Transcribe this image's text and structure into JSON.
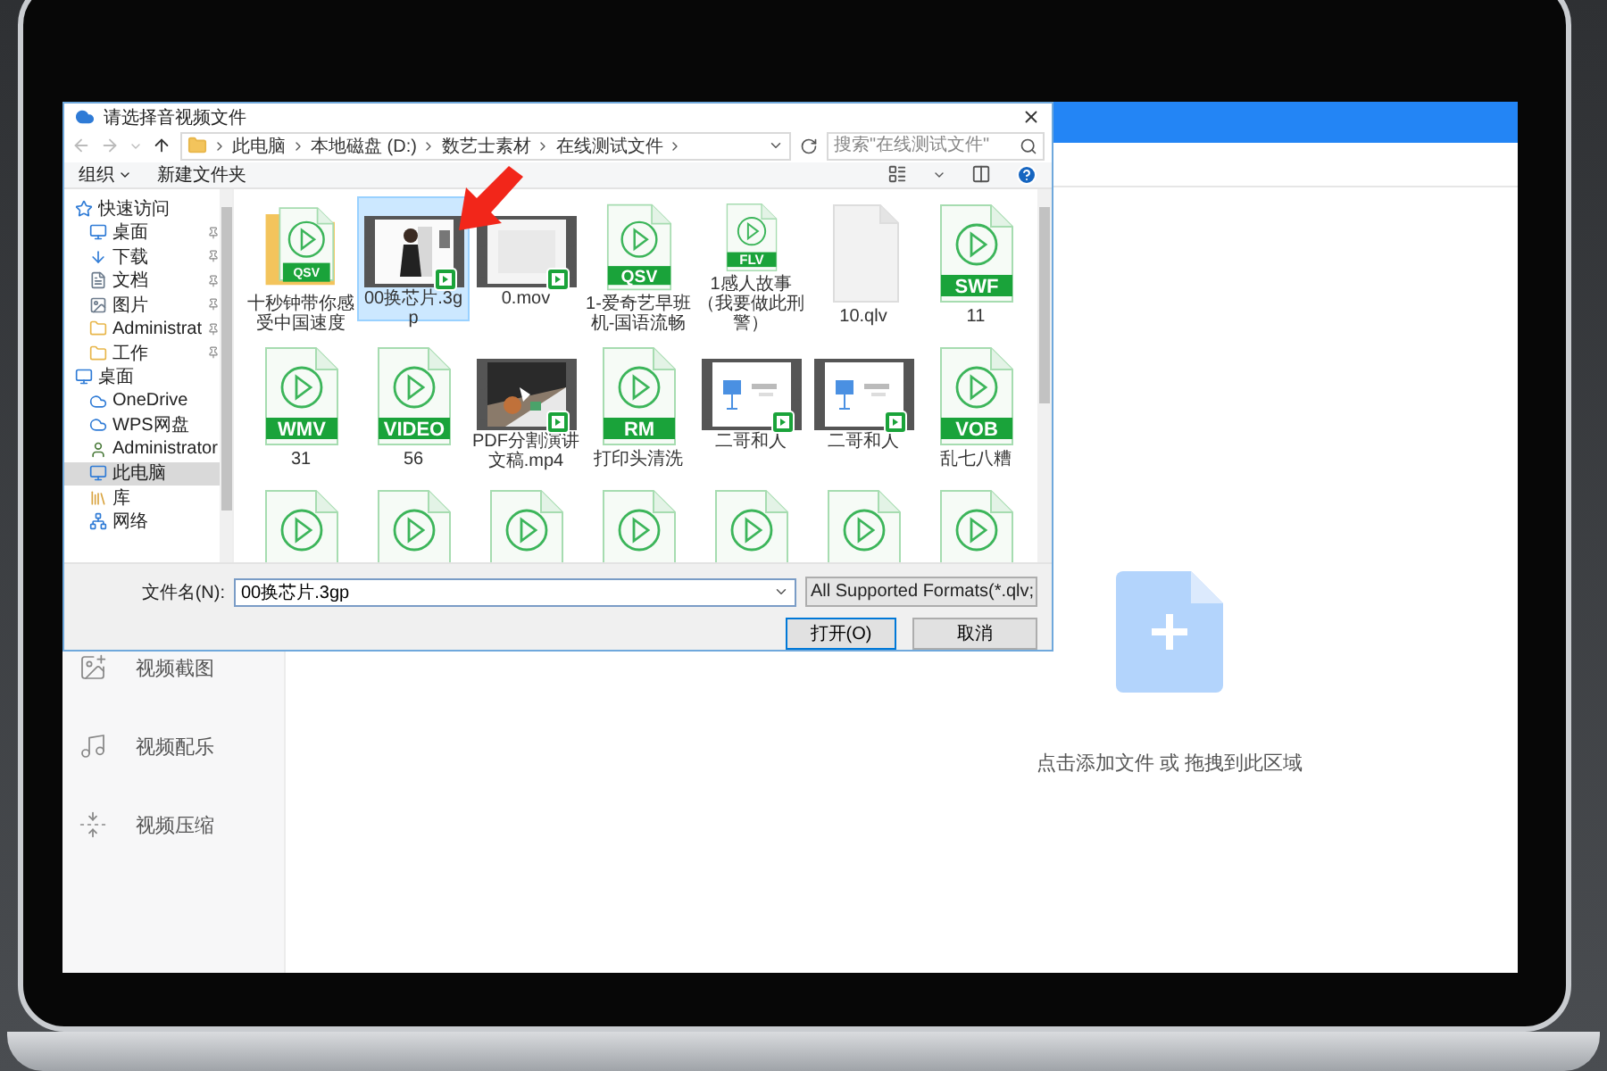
{
  "app": {
    "sidebar": {
      "items": [
        {
          "label": "视频截图",
          "kind": "screenshot"
        },
        {
          "label": "视频配乐",
          "kind": "music"
        },
        {
          "label": "视频压缩",
          "kind": "compress"
        }
      ]
    },
    "drop_zone": {
      "text": "点击添加文件 或 拖拽到此区域"
    }
  },
  "dialog": {
    "title": "请选择音视频文件",
    "path": [
      "此电脑",
      "本地磁盘 (D:)",
      "数艺士素材",
      "在线测试文件"
    ],
    "search": {
      "placeholder": "搜索\"在线测试文件\""
    },
    "toolbar": [
      {
        "label": "组织",
        "dropdown": true
      },
      {
        "label": "新建文件夹",
        "dropdown": false
      }
    ],
    "nav": [
      {
        "label": "快速访问",
        "kind": "star",
        "selected": false,
        "children": [
          {
            "label": "桌面",
            "kind": "desktop",
            "pinned": true,
            "selected": false
          },
          {
            "label": "下载",
            "kind": "download",
            "pinned": true,
            "selected": false
          },
          {
            "label": "文档",
            "kind": "docs",
            "pinned": true,
            "selected": false
          },
          {
            "label": "图片",
            "kind": "pictures",
            "pinned": true,
            "selected": false
          },
          {
            "label": "Administrat",
            "kind": "folder",
            "pinned": true,
            "selected": false
          },
          {
            "label": "工作",
            "kind": "folder",
            "pinned": true,
            "selected": false
          }
        ]
      },
      {
        "label": "桌面",
        "kind": "desktop",
        "selected": false,
        "children": [
          {
            "label": "OneDrive",
            "kind": "cloud",
            "pinned": false,
            "selected": false
          },
          {
            "label": "WPS网盘",
            "kind": "cloud",
            "pinned": false,
            "selected": false
          },
          {
            "label": "Administrator",
            "kind": "user",
            "pinned": false,
            "selected": false
          },
          {
            "label": "此电脑",
            "kind": "computer",
            "pinned": false,
            "selected": true
          },
          {
            "label": "库",
            "kind": "library",
            "pinned": false,
            "selected": false
          },
          {
            "label": "网络",
            "kind": "network",
            "pinned": false,
            "selected": false
          }
        ]
      }
    ],
    "files": [
      {
        "kind": "folder-doc",
        "badge": "QSV",
        "label": "十秒钟带你感受中国速度",
        "selected": false
      },
      {
        "kind": "video",
        "label": "00换芯片.3gp",
        "selected": true
      },
      {
        "kind": "video",
        "label": "0.mov",
        "selected": false
      },
      {
        "kind": "doc",
        "badge": "QSV",
        "label": "1-爱奇艺早班机-国语流畅",
        "selected": false
      },
      {
        "kind": "doc",
        "badge": "FLV",
        "label": "1感人故事（我要做此刑警）",
        "selected": false
      },
      {
        "kind": "blank",
        "label": "10.qlv",
        "selected": false
      },
      {
        "kind": "doc",
        "badge": "SWF",
        "label": "11",
        "selected": false
      },
      {
        "kind": "doc",
        "badge": "WMV",
        "label": "31",
        "selected": false
      },
      {
        "kind": "doc",
        "badge": "VIDEO",
        "label": "56",
        "selected": false
      },
      {
        "kind": "video",
        "label": "PDF分割演讲文稿.mp4",
        "selected": false
      },
      {
        "kind": "doc",
        "badge": "RM",
        "label": "打印头清洗",
        "selected": false
      },
      {
        "kind": "keynote",
        "label": "二哥和人",
        "selected": false
      },
      {
        "kind": "keynote",
        "label": "二哥和人",
        "selected": false
      },
      {
        "kind": "doc",
        "badge": "VOB",
        "label": "乱七八糟",
        "selected": false
      },
      {
        "kind": "doc",
        "selected": false
      },
      {
        "kind": "doc",
        "selected": false
      },
      {
        "kind": "doc",
        "selected": false
      },
      {
        "kind": "doc",
        "selected": false
      },
      {
        "kind": "doc",
        "selected": false
      },
      {
        "kind": "doc",
        "selected": false
      },
      {
        "kind": "doc",
        "selected": false
      }
    ],
    "filename": {
      "label": "文件名(N):",
      "value": "00换芯片.3gp"
    },
    "filter": "All Supported Formats(*.qlv;",
    "buttons": [
      {
        "label": "打开(O)",
        "default": true
      },
      {
        "label": "取消",
        "default": false
      }
    ]
  }
}
